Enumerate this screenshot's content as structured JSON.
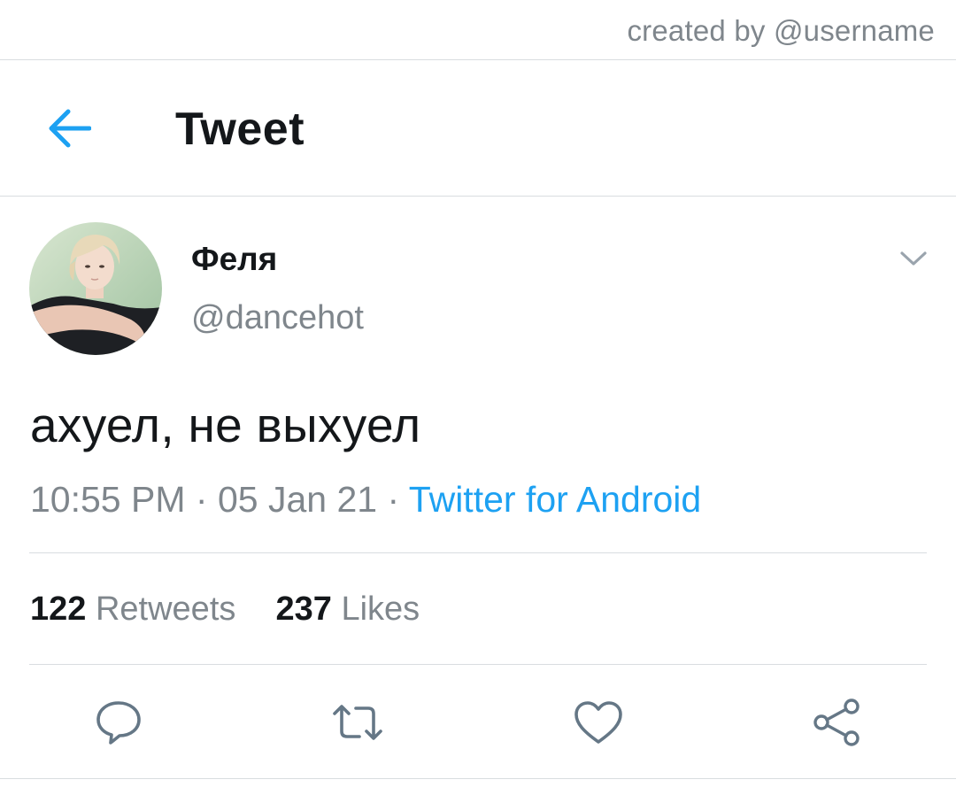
{
  "watermark": {
    "text": "created by @username"
  },
  "header": {
    "title": "Tweet",
    "back_icon": "arrow-left-icon"
  },
  "tweet": {
    "author_name": "Феля",
    "author_handle": "@dancehot",
    "text": "ахуел, не выхуел",
    "time": "10:55 PM",
    "date": "05 Jan 21",
    "separator": "·",
    "source": "Twitter for Android",
    "retweets_count": "122",
    "retweets_label": "Retweets",
    "likes_count": "237",
    "likes_label": "Likes"
  },
  "actions": [
    {
      "name": "reply",
      "icon": "reply-bubble-icon"
    },
    {
      "name": "retweet",
      "icon": "retweet-icon"
    },
    {
      "name": "like",
      "icon": "heart-icon"
    },
    {
      "name": "share",
      "icon": "share-icon"
    }
  ],
  "colors": {
    "accent": "#1da1f2",
    "text_primary": "#14171a",
    "text_secondary": "#7f868c",
    "divider": "#d9dde0",
    "icon_gray": "#657786"
  }
}
